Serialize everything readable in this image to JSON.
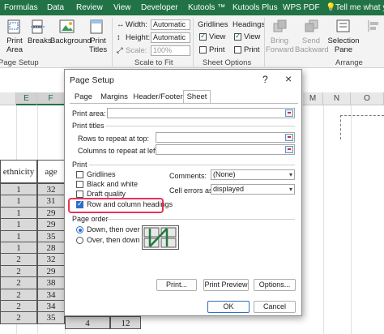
{
  "ribbon_tabs": [
    "Formulas",
    "Data",
    "Review",
    "View",
    "Developer",
    "Kutools ™",
    "Kutools Plus",
    "WPS PDF"
  ],
  "tell_me": "Tell me what you",
  "ribbon": {
    "print_area": "Print\nArea",
    "breaks": "Breaks",
    "background": "Background",
    "print_titles": "Print\nTitles",
    "width_label": "Width:",
    "width_value": "Automatic",
    "height_label": "Height:",
    "height_value": "Automatic",
    "scale_label": "Scale:",
    "scale_value": "100%",
    "gridlines": "Gridlines",
    "headings": "Headings",
    "view": "View",
    "print": "Print",
    "bring_forward": "Bring\nForward",
    "send_backward": "Send\nBackward",
    "selection_pane": "Selection\nPane",
    "group_page_setup": "Page Setup",
    "group_scale": "Scale to Fit",
    "group_sheet": "Sheet Options",
    "group_arrange": "Arrange"
  },
  "grid": {
    "columns": [
      "E",
      "F",
      "M",
      "N",
      "O"
    ],
    "header_row": [
      "ethnicity",
      "age"
    ],
    "rows": [
      [
        "1",
        "32"
      ],
      [
        "1",
        "31"
      ],
      [
        "1",
        "29"
      ],
      [
        "1",
        "29"
      ],
      [
        "1",
        "35"
      ],
      [
        "1",
        "28"
      ],
      [
        "2",
        "32"
      ],
      [
        "2",
        "29"
      ],
      [
        "2",
        "38"
      ],
      [
        "2",
        "34"
      ],
      [
        "2",
        "34"
      ],
      [
        "2",
        "35"
      ]
    ],
    "last_row_extra": [
      "4",
      "12"
    ]
  },
  "dialog": {
    "title": "Page Setup",
    "help": "?",
    "close": "×",
    "tabs": [
      "Page",
      "Margins",
      "Header/Footer",
      "Sheet"
    ],
    "active_tab": "Sheet",
    "print_area_label": "Print area:",
    "print_titles_label": "Print titles",
    "rows_repeat_label": "Rows to repeat at top:",
    "cols_repeat_label": "Columns to repeat at left:",
    "print_section": "Print",
    "gridlines": "Gridlines",
    "black_white": "Black and white",
    "draft_quality": "Draft quality",
    "row_col_headings": "Row and column headings",
    "comments_label": "Comments:",
    "comments_value": "(None)",
    "cell_errors_label": "Cell errors as:",
    "cell_errors_value": "displayed",
    "page_order_label": "Page order",
    "down_then_over": "Down, then over",
    "over_then_down": "Over, then down",
    "print_btn": "Print...",
    "preview_btn": "Print Preview",
    "options_btn": "Options...",
    "ok_btn": "OK",
    "cancel_btn": "Cancel"
  },
  "colors": {
    "excel_green": "#217346",
    "highlight": "#e8335a",
    "accent_blue": "#2d6ec9"
  }
}
